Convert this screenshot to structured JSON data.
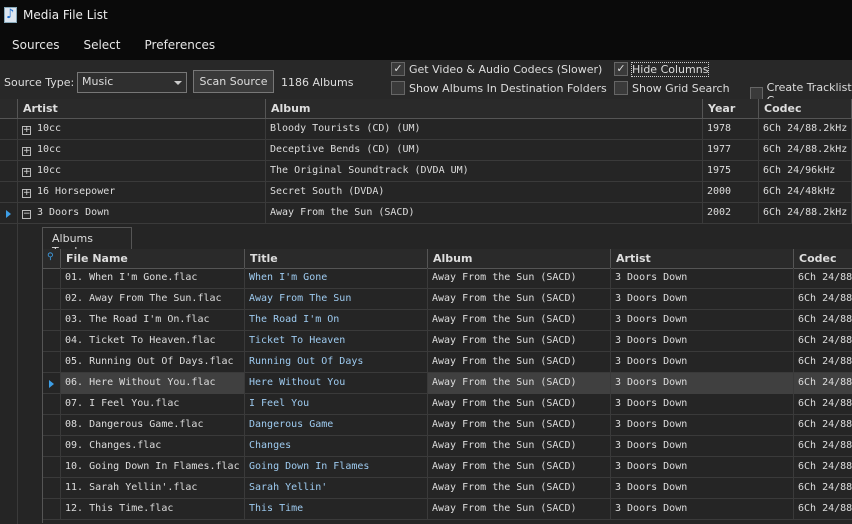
{
  "window": {
    "title": "Media File List"
  },
  "menu": [
    "Sources",
    "Select",
    "Preferences"
  ],
  "toolbar": {
    "source_type_label": "Source Type:",
    "source_type_value": "Music",
    "scan_button": "Scan Source",
    "album_count": "1186 Albums",
    "checkboxes": [
      {
        "label": "Get Video & Audio Codecs (Slower)",
        "checked": true
      },
      {
        "label": "Show Albums In Destination Folders",
        "checked": false
      },
      {
        "label": "Hide Columns",
        "checked": true
      },
      {
        "label": "Show Grid Search",
        "checked": false
      },
      {
        "label": "Create Tracklist C",
        "checked": false
      }
    ]
  },
  "albums": {
    "columns": [
      "Artist",
      "Album",
      "Year",
      "Codec"
    ],
    "rows": [
      [
        "10cc",
        "Bloody Tourists (CD) (UM)",
        "1978",
        "6Ch 24/88.2kHz"
      ],
      [
        "10cc",
        "Deceptive Bends (CD) (UM)",
        "1977",
        "6Ch 24/88.2kHz"
      ],
      [
        "10cc",
        "The Original Soundtrack (DVDA UM)",
        "1975",
        "6Ch 24/96kHz"
      ],
      [
        "16 Horsepower",
        "Secret South (DVDA)",
        "2000",
        "6Ch 24/48kHz"
      ],
      [
        "3 Doors Down",
        "Away From the Sun (SACD)",
        "2002",
        "6Ch 24/88.2kHz"
      ]
    ],
    "expanded_row": 4
  },
  "tracks": {
    "tab": "Albums Tracks",
    "columns": [
      "File Name",
      "Title",
      "Album",
      "Artist",
      "Codec"
    ],
    "selected_row": 5,
    "rows": [
      [
        "01. When I'm Gone.flac",
        "When I'm Gone",
        "Away From the Sun (SACD)",
        "3 Doors Down",
        "6Ch 24/88"
      ],
      [
        "02. Away From The Sun.flac",
        "Away From The Sun",
        "Away From the Sun (SACD)",
        "3 Doors Down",
        "6Ch 24/88"
      ],
      [
        "03. The Road I'm On.flac",
        "The Road I'm On",
        "Away From the Sun (SACD)",
        "3 Doors Down",
        "6Ch 24/88"
      ],
      [
        "04. Ticket To Heaven.flac",
        "Ticket To Heaven",
        "Away From the Sun (SACD)",
        "3 Doors Down",
        "6Ch 24/88"
      ],
      [
        "05. Running Out Of Days.flac",
        "Running Out Of Days",
        "Away From the Sun (SACD)",
        "3 Doors Down",
        "6Ch 24/88"
      ],
      [
        "06. Here Without You.flac",
        "Here Without You",
        "Away From the Sun (SACD)",
        "3 Doors Down",
        "6Ch 24/88"
      ],
      [
        "07. I Feel You.flac",
        "I Feel You",
        "Away From the Sun (SACD)",
        "3 Doors Down",
        "6Ch 24/88"
      ],
      [
        "08. Dangerous Game.flac",
        "Dangerous Game",
        "Away From the Sun (SACD)",
        "3 Doors Down",
        "6Ch 24/88"
      ],
      [
        "09. Changes.flac",
        "Changes",
        "Away From the Sun (SACD)",
        "3 Doors Down",
        "6Ch 24/88"
      ],
      [
        "10. Going Down In Flames.flac",
        "Going Down In Flames",
        "Away From the Sun (SACD)",
        "3 Doors Down",
        "6Ch 24/88"
      ],
      [
        "11. Sarah Yellin'.flac",
        "Sarah Yellin'",
        "Away From the Sun (SACD)",
        "3 Doors Down",
        "6Ch 24/88"
      ],
      [
        "12. This Time.flac",
        "This Time",
        "Away From the Sun (SACD)",
        "3 Doors Down",
        "6Ch 24/88"
      ]
    ]
  }
}
